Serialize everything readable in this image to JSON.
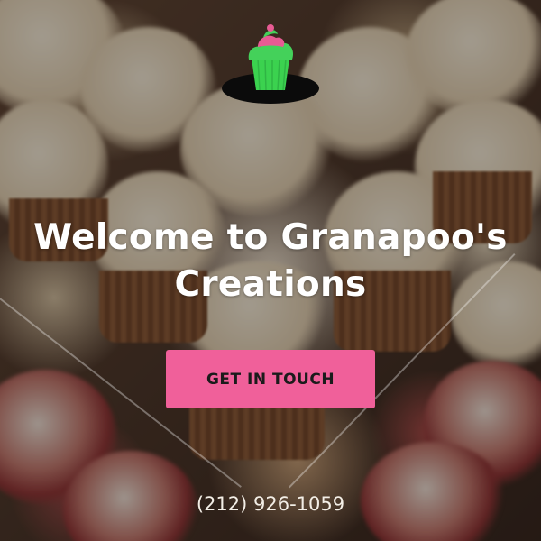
{
  "hero": {
    "title": "Welcome to Granapoo's Creations",
    "cta_label": "GET IN TOUCH",
    "phone": "(212) 926-1059"
  },
  "logo": {
    "icon": "cupcake-logo-icon"
  },
  "colors": {
    "cta_background": "#f0609a",
    "logo_frosting_green": "#44d15a",
    "logo_frosting_pink": "#e85b94",
    "logo_liner": "#3bd24f",
    "text_white": "#ffffff"
  }
}
